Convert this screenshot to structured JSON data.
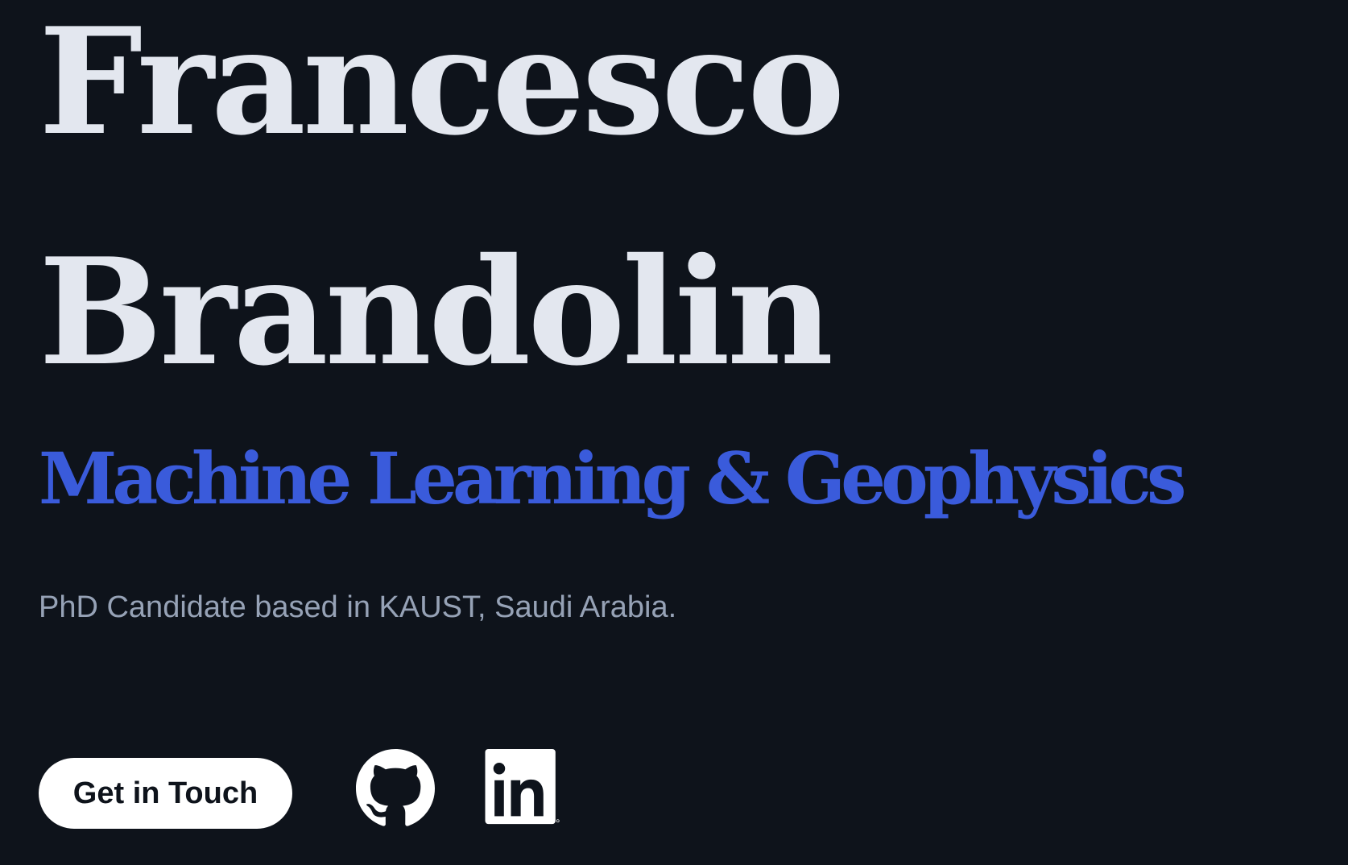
{
  "hero": {
    "first_name": "Francesco",
    "last_name": "Brandolin",
    "tagline": "Machine Learning & Geophysics",
    "bio": "PhD Candidate based in KAUST, Saudi Arabia."
  },
  "actions": {
    "contact_label": "Get in Touch",
    "social": [
      {
        "name": "github",
        "icon": "github-icon"
      },
      {
        "name": "linkedin",
        "icon": "linkedin-icon"
      }
    ]
  },
  "colors": {
    "background": "#0e131b",
    "heading": "#e3e7ef",
    "accent": "#3a5bdb",
    "muted_text": "#96a2b6",
    "button_bg": "#ffffff"
  }
}
